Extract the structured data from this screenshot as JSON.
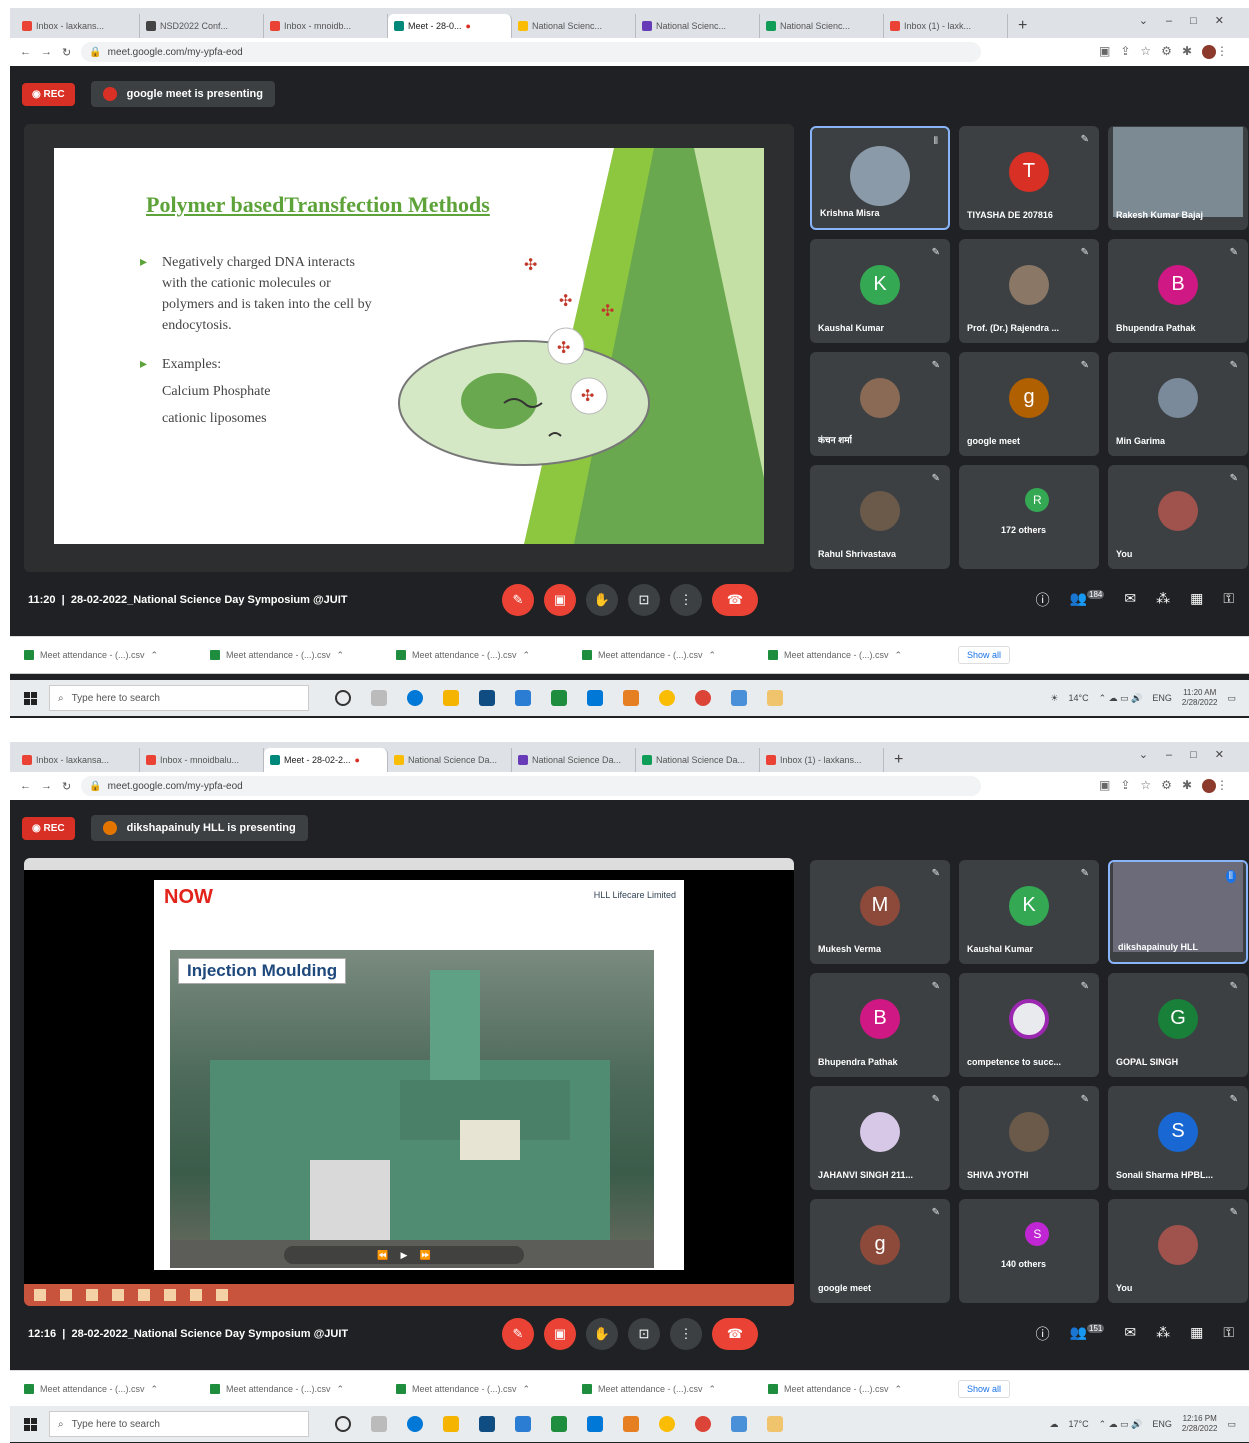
{
  "screens": [
    {
      "tabs": [
        "Inbox - laxkans...",
        "NSD2022 Conf...",
        "Inbox - mnoidb...",
        "Meet - 28-0...",
        "National Scienc...",
        "National Scienc...",
        "National Scienc...",
        "Inbox (1) - laxk..."
      ],
      "url": "meet.google.com/my-ypfa-eod",
      "rec_label": "REC",
      "presenting_label": "google meet is presenting",
      "presenter_color": "#d93025",
      "slide": {
        "title": "Polymer basedTransfection Methods",
        "bullet1": "Negatively charged DNA interacts with the cationic molecules or polymers and is taken into the cell by endocytosis.",
        "bullet2_head": "Examples:",
        "bullet2_line1": "Calcium Phosphate",
        "bullet2_line2": "cationic liposomes"
      },
      "participants": [
        {
          "name": "Krishna Misra",
          "initial": "",
          "color": "#5f6368"
        },
        {
          "name": "TIYASHA DE 207816",
          "initial": "T",
          "color": "#d93025"
        },
        {
          "name": "Rakesh Kumar Bajaj",
          "initial": "",
          "color": "#5f6368"
        },
        {
          "name": "Kaushal Kumar",
          "initial": "K",
          "color": "#34a853"
        },
        {
          "name": "Prof. (Dr.) Rajendra ...",
          "initial": "",
          "color": "#8a7766"
        },
        {
          "name": "Bhupendra Pathak",
          "initial": "B",
          "color": "#d01884"
        },
        {
          "name": "कंचन शर्मा",
          "initial": "",
          "color": "#8a6a55"
        },
        {
          "name": "google meet",
          "initial": "g",
          "color": "#b06000"
        },
        {
          "name": "Min Garima",
          "initial": "",
          "color": "#7a8a9a"
        },
        {
          "name": "Rahul Shrivastava",
          "initial": "",
          "color": "#6b5a4a"
        },
        {
          "name": "172 others",
          "initial": "R",
          "color": "#34a853"
        },
        {
          "name": "You",
          "initial": "",
          "color": "#a0524d"
        }
      ],
      "meeting_time": "11:20",
      "meeting_title": "28-02-2022_National Science Day Symposium @JUIT",
      "people_count": "184",
      "download_label": "Meet attendance - (...).csv",
      "show_all": "Show all",
      "search_placeholder": "Type here to search",
      "temperature": "14°C",
      "language": "ENG",
      "clock_time": "11:20 AM",
      "clock_date": "2/28/2022"
    },
    {
      "tabs": [
        "Inbox - laxkansa...",
        "Inbox - mnoidbalu...",
        "Meet - 28-02-2...",
        "National Science Da...",
        "National Science Da...",
        "National Science Da...",
        "Inbox (1) - laxkans..."
      ],
      "url": "meet.google.com/my-ypfa-eod",
      "rec_label": "REC",
      "presenting_label": "dikshapainuly HLL is presenting",
      "presenter_color": "#e37400",
      "video": {
        "now_label": "NOW",
        "company": "HLL Lifecare Limited",
        "slide_title": "Injection Moulding"
      },
      "participants": [
        {
          "name": "Mukesh Verma",
          "initial": "M",
          "color": "#8d4a3a"
        },
        {
          "name": "Kaushal Kumar",
          "initial": "K",
          "color": "#34a853"
        },
        {
          "name": "dikshapainuly HLL",
          "initial": "",
          "color": "#6b6b7a"
        },
        {
          "name": "Bhupendra Pathak",
          "initial": "B",
          "color": "#d01884"
        },
        {
          "name": "competence to succ...",
          "initial": "",
          "color": "#e8eaed"
        },
        {
          "name": "GOPAL SINGH",
          "initial": "G",
          "color": "#188038"
        },
        {
          "name": "JAHANVI SINGH 211...",
          "initial": "",
          "color": "#d8c8e8"
        },
        {
          "name": "SHIVA JYOTHI",
          "initial": "",
          "color": "#6b5a4a"
        },
        {
          "name": "Sonali Sharma HPBL...",
          "initial": "S",
          "color": "#1967d2"
        },
        {
          "name": "google meet",
          "initial": "g",
          "color": "#8d4a3a"
        },
        {
          "name": "140 others",
          "initial": "S",
          "color": "#c026d3"
        },
        {
          "name": "You",
          "initial": "",
          "color": "#a0524d"
        }
      ],
      "meeting_time": "12:16",
      "meeting_title": "28-02-2022_National Science Day Symposium @JUIT",
      "people_count": "151",
      "download_label": "Meet attendance - (...).csv",
      "show_all": "Show all",
      "search_placeholder": "Type here to search",
      "temperature": "17°C",
      "language": "ENG",
      "clock_time": "12:16 PM",
      "clock_date": "2/28/2022"
    }
  ],
  "icons": {
    "mic_off": "mic-off-icon",
    "cam_off": "camera-off-icon",
    "hand": "raise-hand-icon",
    "present": "present-icon",
    "more": "more-options-icon",
    "end": "end-call-icon",
    "info": "info-icon",
    "people": "people-icon",
    "chat": "chat-icon",
    "activities": "activities-icon",
    "layout": "layout-icon",
    "lock": "host-controls-icon"
  }
}
